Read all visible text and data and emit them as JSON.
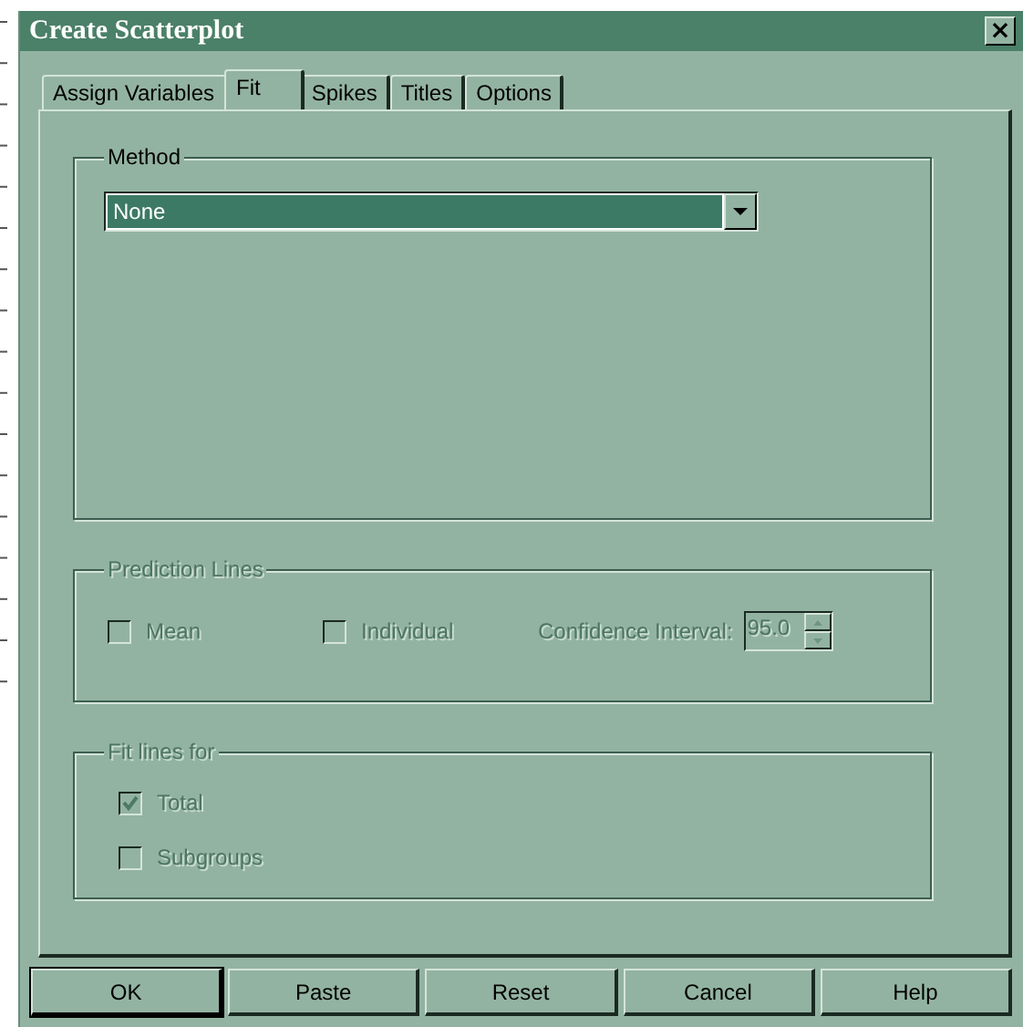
{
  "window": {
    "title": "Create Scatterplot",
    "close": "×"
  },
  "tabs": [
    {
      "label": "Assign Variables",
      "selected": false
    },
    {
      "label": "Fit",
      "selected": true
    },
    {
      "label": "Spikes",
      "selected": false
    },
    {
      "label": "Titles",
      "selected": false
    },
    {
      "label": "Options",
      "selected": false
    }
  ],
  "method": {
    "legend": "Method",
    "value": "None",
    "disabled": false
  },
  "prediction_lines": {
    "legend": "Prediction Lines",
    "disabled": true,
    "options": [
      {
        "label": "Mean",
        "checked": false
      },
      {
        "label": "Individual",
        "checked": false
      }
    ],
    "confidence_interval": {
      "label": "Confidence Interval:",
      "value": "95.0"
    }
  },
  "fit_lines_for": {
    "legend": "Fit lines for",
    "disabled": true,
    "options": [
      {
        "label": "Total",
        "checked": true
      },
      {
        "label": "Subgroups",
        "checked": false
      }
    ]
  },
  "buttons": [
    {
      "label": "OK",
      "default": true
    },
    {
      "label": "Paste",
      "default": false
    },
    {
      "label": "Reset",
      "default": false
    },
    {
      "label": "Cancel",
      "default": false
    },
    {
      "label": "Help",
      "default": false
    }
  ]
}
